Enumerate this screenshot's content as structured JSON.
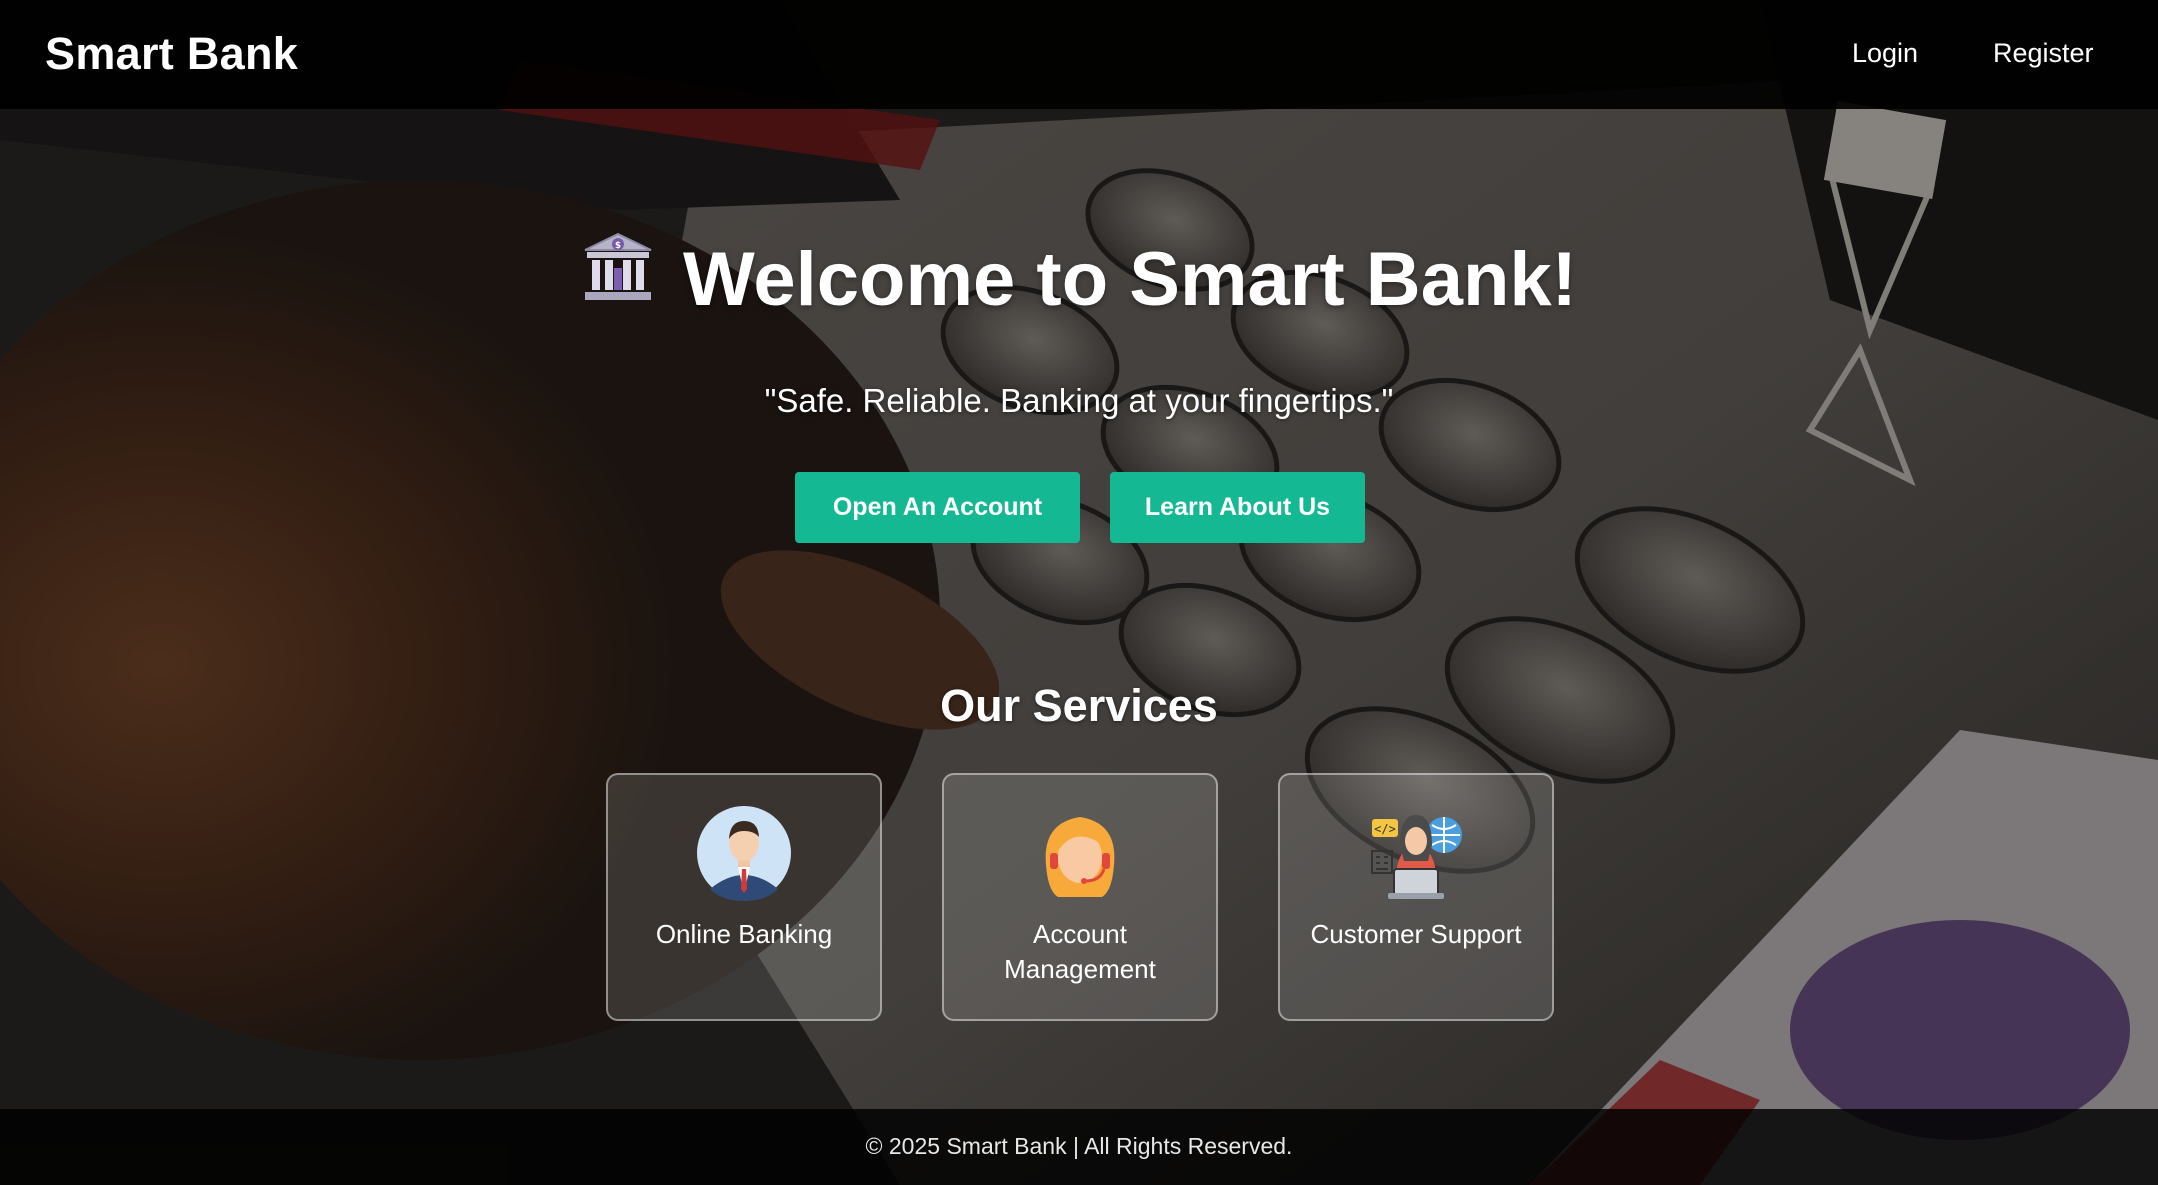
{
  "header": {
    "brand": "Smart Bank",
    "nav": {
      "login": "Login",
      "register": "Register"
    }
  },
  "hero": {
    "icon": "bank-building-icon",
    "title": "Welcome to Smart Bank!",
    "tagline": "\"Safe. Reliable. Banking at your fingertips.\"",
    "buttons": {
      "open_account": "Open An Account",
      "learn_about": "Learn About Us"
    }
  },
  "services": {
    "title": "Our Services",
    "items": [
      {
        "label": "Online Banking",
        "icon": "businessman-avatar-icon"
      },
      {
        "label": "Account Management",
        "icon": "support-agent-headset-icon"
      },
      {
        "label": "Customer Support",
        "icon": "hacker-laptop-globe-icon"
      }
    ]
  },
  "footer": {
    "text": "© 2025 Smart Bank | All Rights Reserved."
  },
  "colors": {
    "accent": "#14b893",
    "navbar": "#000000",
    "text": "#ffffff"
  }
}
